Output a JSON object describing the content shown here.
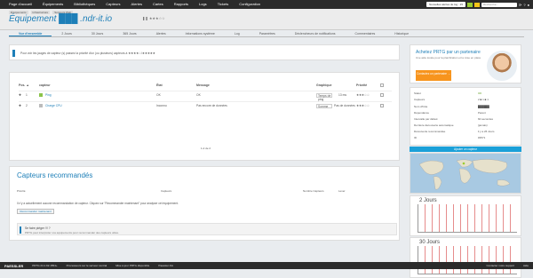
{
  "topbar": {
    "menu": [
      "Page d'accueil",
      "Équipements",
      "Bibliothèques",
      "Capteurs",
      "Alertes",
      "Cartes",
      "Rapports",
      "Logs",
      "Tickets",
      "Configuration"
    ],
    "alerts_label": "Nouvelles alertes de log : 15",
    "ok_count": "1",
    "warn_count": "2",
    "search_placeholder": "Recherche..."
  },
  "header": {
    "breadcrumbs": [
      "Équipements",
      "Infrastructure",
      "Serveurs Web"
    ],
    "title": "Équipement ███ .ndr-it.io",
    "stars": "★★★☆☆"
  },
  "tabs": [
    "Vue d'ensemble",
    "2 Jours",
    "30 Jours",
    "365 Jours",
    "Alertes",
    "Informations système",
    "Log",
    "Paramètres",
    "Déclencheurs de notifications",
    "Commentaires",
    "Historique"
  ],
  "gauge_text": "Pour voir les jauges de capteur (s) passez la priorité d'un (ou plusieurs) capteurs à ★★★★☆/★★★★★",
  "table": {
    "headers": [
      "Pos. ▲",
      "capteur",
      "État",
      "Message",
      "Graphique",
      "Priorité"
    ],
    "rows": [
      {
        "pos": "1",
        "name": "Ping",
        "state": "OK",
        "message": "OK",
        "graph": "Temps de ping",
        "graph_value": "13 ms",
        "priority": "★★★☆☆"
      },
      {
        "pos": "2",
        "name": "Charge CPU",
        "state": "Inconnu",
        "message": "Pas encore de données",
        "graph": "Somme",
        "graph_value": "Pas de données",
        "priority": "★★★☆☆"
      }
    ],
    "pager": "1-2 de 2"
  },
  "recommend": {
    "title": "Capteurs recommandés",
    "columns": [
      "Priorité",
      "Capteurs",
      "Nombre Capteurs",
      "Lever"
    ],
    "note": "Il n'y a actuellement aucune recommandation de capteur. Cliquez sur \"Recommander maintenant\" pour analyser cet équipement.",
    "button": "Recommander maintenant",
    "info_title": "Se faire piéger !!! ?",
    "info_text": "PRTG peut interpréter vos équipements pour recommander des capteurs utiles."
  },
  "side": {
    "ad_title": "Achetez PRTG par un partenaire",
    "ad_sub": "Une aide locale pour la planification et la mise en place",
    "ad_cta": "Contactez un partenaire →",
    "details": [
      [
        "Statut",
        "OK"
      ],
      [
        "Capteurs",
        "2  ■ 1  ■ 1"
      ],
      [
        "Nom d'hôte",
        "██████"
      ],
      [
        "Dépendance",
        "Parent"
      ],
      [
        "Intervalle par défaut",
        "60 secondes"
      ],
      [
        "Dernière découverte automatique",
        "(jamais)"
      ],
      [
        "Découverte recommandée",
        "il y a 26 Jours"
      ],
      [
        "ID",
        "#3571"
      ]
    ],
    "add_sensor": "Ajouter un capteur",
    "chart1_title": "2 Jours",
    "chart2_title": "30 Jours"
  },
  "footer": {
    "logo": "PAESSLER",
    "left": [
      "PRTG 24.1.92.1554+",
      "Processeurs sur le serveur central",
      "Mise à jour PRTG disponible",
      "Paessler AG"
    ],
    "right": [
      "Contacter notre support",
      "Aide"
    ]
  },
  "colors": {
    "accent": "#1e7fb8",
    "ok": "#9acd32",
    "warning": "#f5c518",
    "cta": "#f7941d"
  }
}
